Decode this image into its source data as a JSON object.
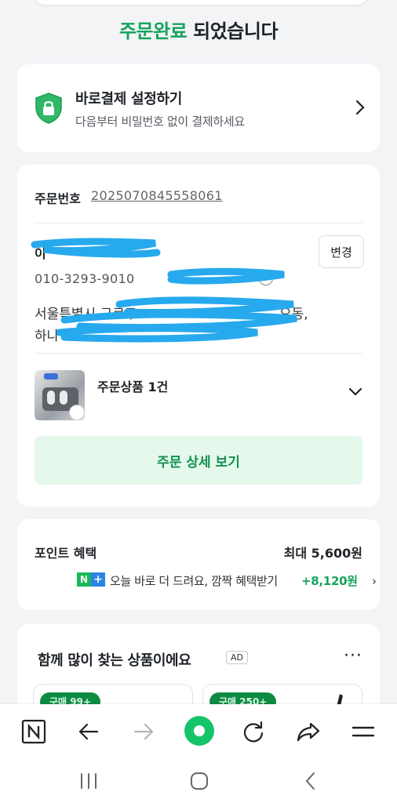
{
  "heading": {
    "accent": "주문완료",
    "rest": " 되었습니다"
  },
  "quick_pay": {
    "title": "바로결제 설정하기",
    "subtitle": "다음부터 비밀번호 없이 결제하세요"
  },
  "order": {
    "number_label": "주문번호",
    "number_value": "2025070845558061",
    "recipient_prefix": "이",
    "change_label": "변경",
    "phone_visible": "010-3293-9010",
    "address_line1_start": "서울특별시 구로구",
    "address_line1_end": "오동,",
    "address_line2_start": "하나",
    "product_label": "주문상품 1건",
    "detail_button": "주문 상세 보기"
  },
  "points": {
    "title": "포인트 혜택",
    "max_label": "최대 5,600원",
    "badge_n": "N",
    "badge_plus": "+",
    "description": "오늘 바로 더 드려요, 깜짝 혜택받기",
    "bonus": "+8,120원",
    "chevron": "›"
  },
  "recommend": {
    "title": "함께 많이 찾는 상품이에요",
    "ad_label": "AD",
    "more": "···",
    "item1_badge": "구매 99+",
    "item2_badge": "구매 250+"
  },
  "browser_bar": {
    "icons": [
      "naver-n-icon",
      "back-arrow-icon",
      "forward-arrow-icon",
      "home-green-icon",
      "refresh-icon",
      "share-icon",
      "menu-icon"
    ]
  },
  "nav_bar": {
    "icons": [
      "recent-apps-icon",
      "home-icon",
      "back-icon"
    ]
  },
  "colors": {
    "accent_green": "#15a35a",
    "detail_button_bg": "#e4f8ec",
    "detail_button_text": "#12914f",
    "scribble_blue": "#27a9ee"
  }
}
